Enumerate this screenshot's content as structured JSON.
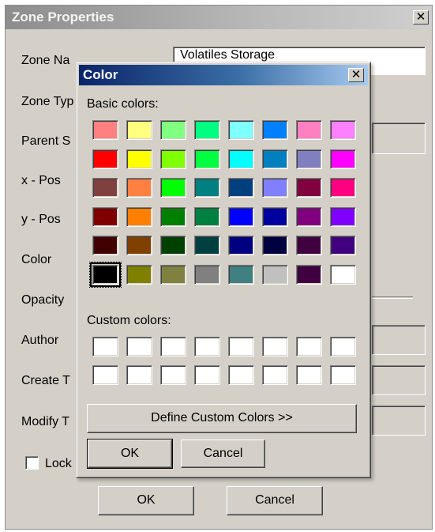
{
  "zone_dialog": {
    "title": "Zone Properties",
    "close_glyph": "✕",
    "labels": {
      "zone_name": "Zone Na",
      "zone_type": "Zone Typ",
      "parent": "Parent S",
      "x_pos": "x - Pos",
      "y_pos": "y - Pos",
      "color": "Color",
      "opacity": "Opacity",
      "author": "Author",
      "create_time": "Create T",
      "modify_time": "Modify T",
      "lock": "Lock"
    },
    "zone_name_value": "Volatiles Storage",
    "ok_label": "OK",
    "cancel_label": "Cancel"
  },
  "color_dialog": {
    "title": "Color",
    "close_glyph": "✕",
    "basic_colors_label": "Basic colors:",
    "basic_colors": [
      "#ff8080",
      "#ffff80",
      "#80ff80",
      "#00ff80",
      "#80ffff",
      "#0080ff",
      "#ff80c0",
      "#ff80ff",
      "#ff0000",
      "#ffff00",
      "#80ff00",
      "#00ff40",
      "#00ffff",
      "#0080c0",
      "#8080c0",
      "#ff00ff",
      "#804040",
      "#ff8040",
      "#00ff00",
      "#008080",
      "#004080",
      "#8080ff",
      "#800040",
      "#ff0080",
      "#800000",
      "#ff8000",
      "#008000",
      "#008040",
      "#0000ff",
      "#0000a0",
      "#800080",
      "#8000ff",
      "#400000",
      "#804000",
      "#004000",
      "#004040",
      "#000080",
      "#000040",
      "#400040",
      "#400080",
      "#000000",
      "#808000",
      "#808040",
      "#808080",
      "#408080",
      "#c0c0c0",
      "#400040",
      "#ffffff"
    ],
    "selected_index": 40,
    "custom_colors_label": "Custom colors:",
    "custom_colors": [
      "#ffffff",
      "#ffffff",
      "#ffffff",
      "#ffffff",
      "#ffffff",
      "#ffffff",
      "#ffffff",
      "#ffffff",
      "#ffffff",
      "#ffffff",
      "#ffffff",
      "#ffffff",
      "#ffffff",
      "#ffffff",
      "#ffffff",
      "#ffffff"
    ],
    "define_custom_label": "Define Custom Colors >>",
    "ok_label": "OK",
    "cancel_label": "Cancel"
  }
}
